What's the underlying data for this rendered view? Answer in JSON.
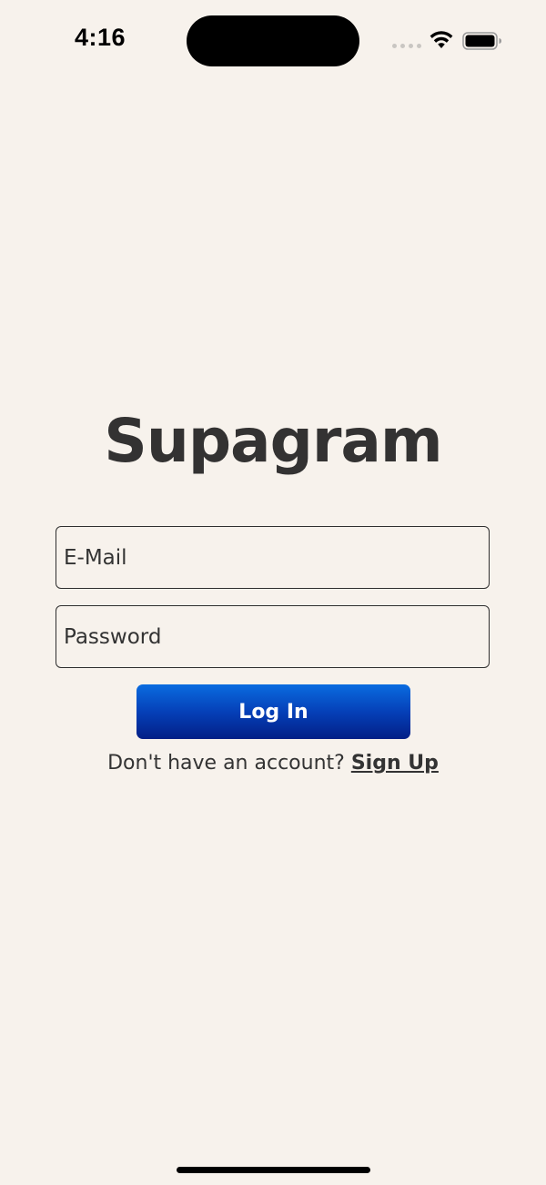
{
  "status_bar": {
    "time": "4:16"
  },
  "app": {
    "title": "Supagram"
  },
  "form": {
    "email": {
      "placeholder": "E-Mail",
      "value": ""
    },
    "password": {
      "placeholder": "Password",
      "value": ""
    },
    "login_label": "Log In",
    "signup_prompt": "Don't have an account? ",
    "signup_link": "Sign Up"
  },
  "colors": {
    "background": "#f7f2ec",
    "button_top": "#0a6ce0",
    "button_bottom": "#031f86",
    "text": "#333333"
  },
  "icons": {
    "signal": "cellular-signal-icon",
    "wifi": "wifi-icon",
    "battery": "battery-icon"
  }
}
